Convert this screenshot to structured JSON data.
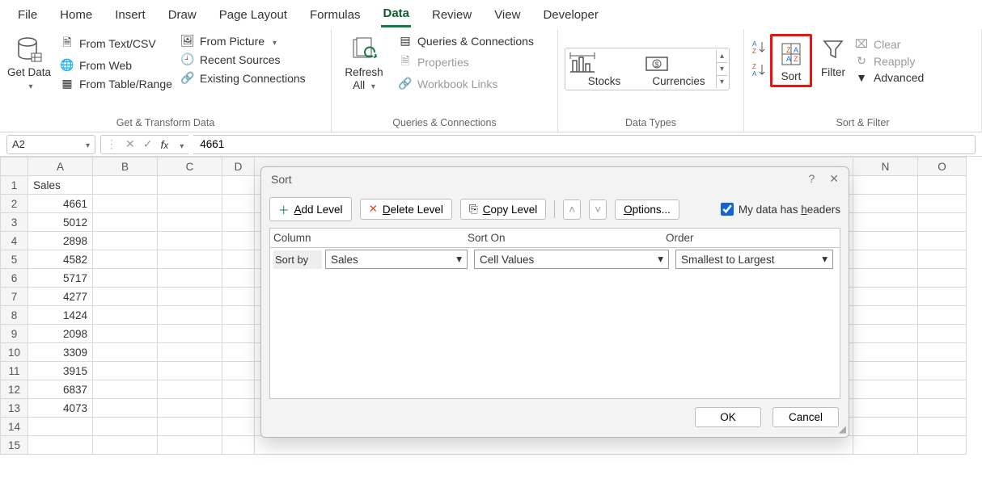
{
  "ribbon_tabs": [
    "File",
    "Home",
    "Insert",
    "Draw",
    "Page Layout",
    "Formulas",
    "Data",
    "Review",
    "View",
    "Developer"
  ],
  "active_tab": "Data",
  "groups": {
    "get_transform": {
      "label": "Get & Transform Data",
      "get_data": "Get Data",
      "from_textcsv": "From Text/CSV",
      "from_web": "From Web",
      "from_table": "From Table/Range",
      "from_picture": "From Picture",
      "recent_sources": "Recent Sources",
      "existing_conn": "Existing Connections"
    },
    "queries": {
      "label": "Queries & Connections",
      "refresh": "Refresh All",
      "queries": "Queries & Connections",
      "properties": "Properties",
      "links": "Workbook Links"
    },
    "datatypes": {
      "label": "Data Types",
      "stocks": "Stocks",
      "currencies": "Currencies"
    },
    "sortfilter": {
      "label": "Sort & Filter",
      "sort": "Sort",
      "filter": "Filter",
      "clear": "Clear",
      "reapply": "Reapply",
      "advanced": "Advanced"
    }
  },
  "namebox": "A2",
  "formula": "4661",
  "sheet": {
    "columns": [
      "A",
      "B",
      "C",
      "D",
      "N",
      "O"
    ],
    "partial_col": "D",
    "rows": [
      {
        "n": 1,
        "A": "Sales"
      },
      {
        "n": 2,
        "A": "4661"
      },
      {
        "n": 3,
        "A": "5012"
      },
      {
        "n": 4,
        "A": "2898"
      },
      {
        "n": 5,
        "A": "4582"
      },
      {
        "n": 6,
        "A": "5717"
      },
      {
        "n": 7,
        "A": "4277"
      },
      {
        "n": 8,
        "A": "1424"
      },
      {
        "n": 9,
        "A": "2098"
      },
      {
        "n": 10,
        "A": "3309"
      },
      {
        "n": 11,
        "A": "3915"
      },
      {
        "n": 12,
        "A": "6837"
      },
      {
        "n": 13,
        "A": "4073"
      },
      {
        "n": 14,
        "A": ""
      },
      {
        "n": 15,
        "A": ""
      }
    ]
  },
  "dialog": {
    "title": "Sort",
    "add_level": "Add Level",
    "delete_level": "Delete Level",
    "copy_level": "Copy Level",
    "options": "Options...",
    "headers_label": "My data has headers",
    "headers_checked": true,
    "col_header": "Column",
    "sorton_header": "Sort On",
    "order_header": "Order",
    "sortby_label": "Sort by",
    "sortby_value": "Sales",
    "sorton_value": "Cell Values",
    "order_value": "Smallest to Largest",
    "ok": "OK",
    "cancel": "Cancel"
  }
}
